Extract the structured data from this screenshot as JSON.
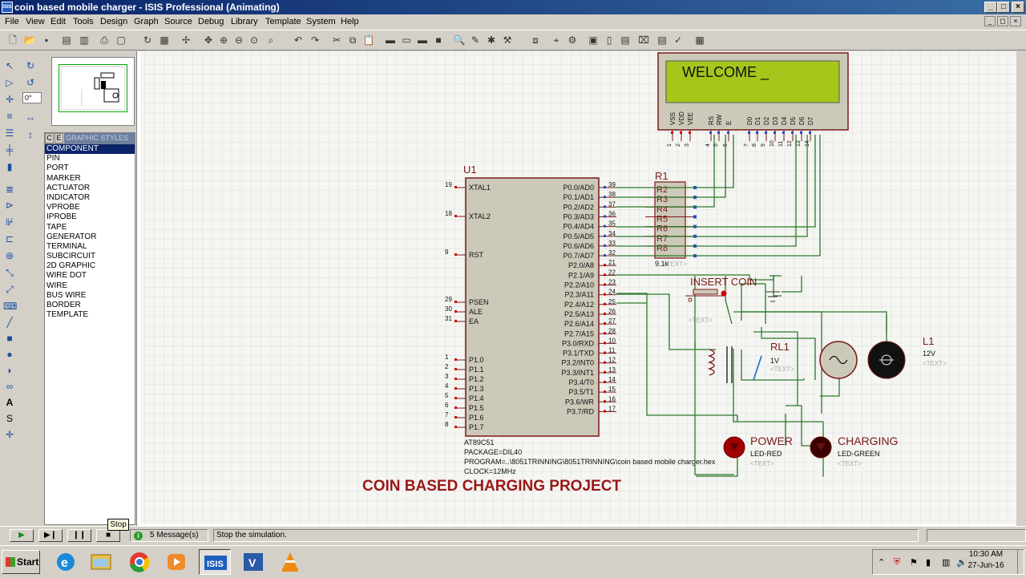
{
  "window": {
    "title": "coin based mobile charger - ISIS Professional (Animating)",
    "icon_text": "ISIS"
  },
  "menu": [
    "File",
    "View",
    "Edit",
    "Tools",
    "Design",
    "Graph",
    "Source",
    "Debug",
    "Library",
    "Template",
    "System",
    "Help"
  ],
  "rotation": {
    "value": "0°"
  },
  "selector": {
    "tabs": [
      "C",
      "E"
    ],
    "header": "GRAPHIC STYLES",
    "items": [
      "COMPONENT",
      "PIN",
      "PORT",
      "MARKER",
      "ACTUATOR",
      "INDICATOR",
      "VPROBE",
      "IPROBE",
      "TAPE",
      "GENERATOR",
      "TERMINAL",
      "SUBCIRCUIT",
      "2D GRAPHIC",
      "WIRE DOT",
      "WIRE",
      "BUS WIRE",
      "BORDER",
      "TEMPLATE"
    ],
    "selected": "COMPONENT"
  },
  "schematic": {
    "lcd_text": "WELCOME _",
    "lcd_pins": [
      "VSS",
      "VDD",
      "VEE",
      "RS",
      "RW",
      "E",
      "D0",
      "D1",
      "D2",
      "D3",
      "D4",
      "D5",
      "D6",
      "D7"
    ],
    "lcd_pin_numbers": [
      "1",
      "2",
      "3",
      "4",
      "5",
      "6",
      "7",
      "8",
      "9",
      "10",
      "11",
      "12",
      "13",
      "14"
    ],
    "mcu": {
      "ref": "U1",
      "part": "AT89C51",
      "package": "PACKAGE=DIL40",
      "program": "PROGRAM=..\\8051TRINNING\\8051TRINNING\\coin based mobile charger.hex",
      "clock": "CLOCK=12MHz",
      "left_pins": [
        {
          "num": "19",
          "name": "XTAL1"
        },
        {
          "num": "18",
          "name": "XTAL2"
        },
        {
          "num": "9",
          "name": "RST"
        },
        {
          "num": "29",
          "name": "PSEN"
        },
        {
          "num": "30",
          "name": "ALE"
        },
        {
          "num": "31",
          "name": "EA"
        },
        {
          "num": "1",
          "name": "P1.0"
        },
        {
          "num": "2",
          "name": "P1.1"
        },
        {
          "num": "3",
          "name": "P1.2"
        },
        {
          "num": "4",
          "name": "P1.3"
        },
        {
          "num": "5",
          "name": "P1.4"
        },
        {
          "num": "6",
          "name": "P1.5"
        },
        {
          "num": "7",
          "name": "P1.6"
        },
        {
          "num": "8",
          "name": "P1.7"
        }
      ],
      "right_pins": [
        {
          "num": "39",
          "name": "P0.0/AD0"
        },
        {
          "num": "38",
          "name": "P0.1/AD1"
        },
        {
          "num": "37",
          "name": "P0.2/AD2"
        },
        {
          "num": "36",
          "name": "P0.3/AD3"
        },
        {
          "num": "35",
          "name": "P0.4/AD4"
        },
        {
          "num": "34",
          "name": "P0.5/AD5"
        },
        {
          "num": "33",
          "name": "P0.6/AD6"
        },
        {
          "num": "32",
          "name": "P0.7/AD7"
        },
        {
          "num": "21",
          "name": "P2.0/A8"
        },
        {
          "num": "22",
          "name": "P2.1/A9"
        },
        {
          "num": "23",
          "name": "P2.2/A10"
        },
        {
          "num": "24",
          "name": "P2.3/A11"
        },
        {
          "num": "25",
          "name": "P2.4/A12"
        },
        {
          "num": "26",
          "name": "P2.5/A13"
        },
        {
          "num": "27",
          "name": "P2.6/A14"
        },
        {
          "num": "28",
          "name": "P2.7/A15"
        },
        {
          "num": "10",
          "name": "P3.0/RXD"
        },
        {
          "num": "11",
          "name": "P3.1/TXD"
        },
        {
          "num": "12",
          "name": "P3.2/INT0"
        },
        {
          "num": "13",
          "name": "P3.3/INT1"
        },
        {
          "num": "14",
          "name": "P3.4/T0"
        },
        {
          "num": "15",
          "name": "P3.5/T1"
        },
        {
          "num": "16",
          "name": "P3.6/WR"
        },
        {
          "num": "17",
          "name": "P3.7/RD"
        }
      ]
    },
    "rpack": {
      "ref": "R1",
      "labels": [
        "R2",
        "R3",
        "R4",
        "R5",
        "R6",
        "R7",
        "R8"
      ],
      "value": "9.1k",
      "text": "<TEXT>"
    },
    "button": {
      "label": "INSERT COIN",
      "text": "<TEXT>"
    },
    "relay": {
      "ref": "RL1",
      "value": "1V",
      "text": "<TEXT>"
    },
    "lamp": {
      "ref": "L1",
      "value": "12V",
      "text": "<TEXT>"
    },
    "led_power": {
      "label": "POWER",
      "type": "LED-RED",
      "text": "<TEXT>"
    },
    "led_charging": {
      "label": "CHARGING",
      "type": "LED-GREEN",
      "text": "<TEXT>"
    },
    "project_title": "COIN BASED CHARGING PROJECT"
  },
  "statusbar": {
    "messages": "5 Message(s)",
    "status_text": "Stop the simulation.",
    "tooltip": "Stop"
  },
  "taskbar": {
    "start": "Start",
    "time": "10:30 AM",
    "date": "27-Jun-16"
  }
}
